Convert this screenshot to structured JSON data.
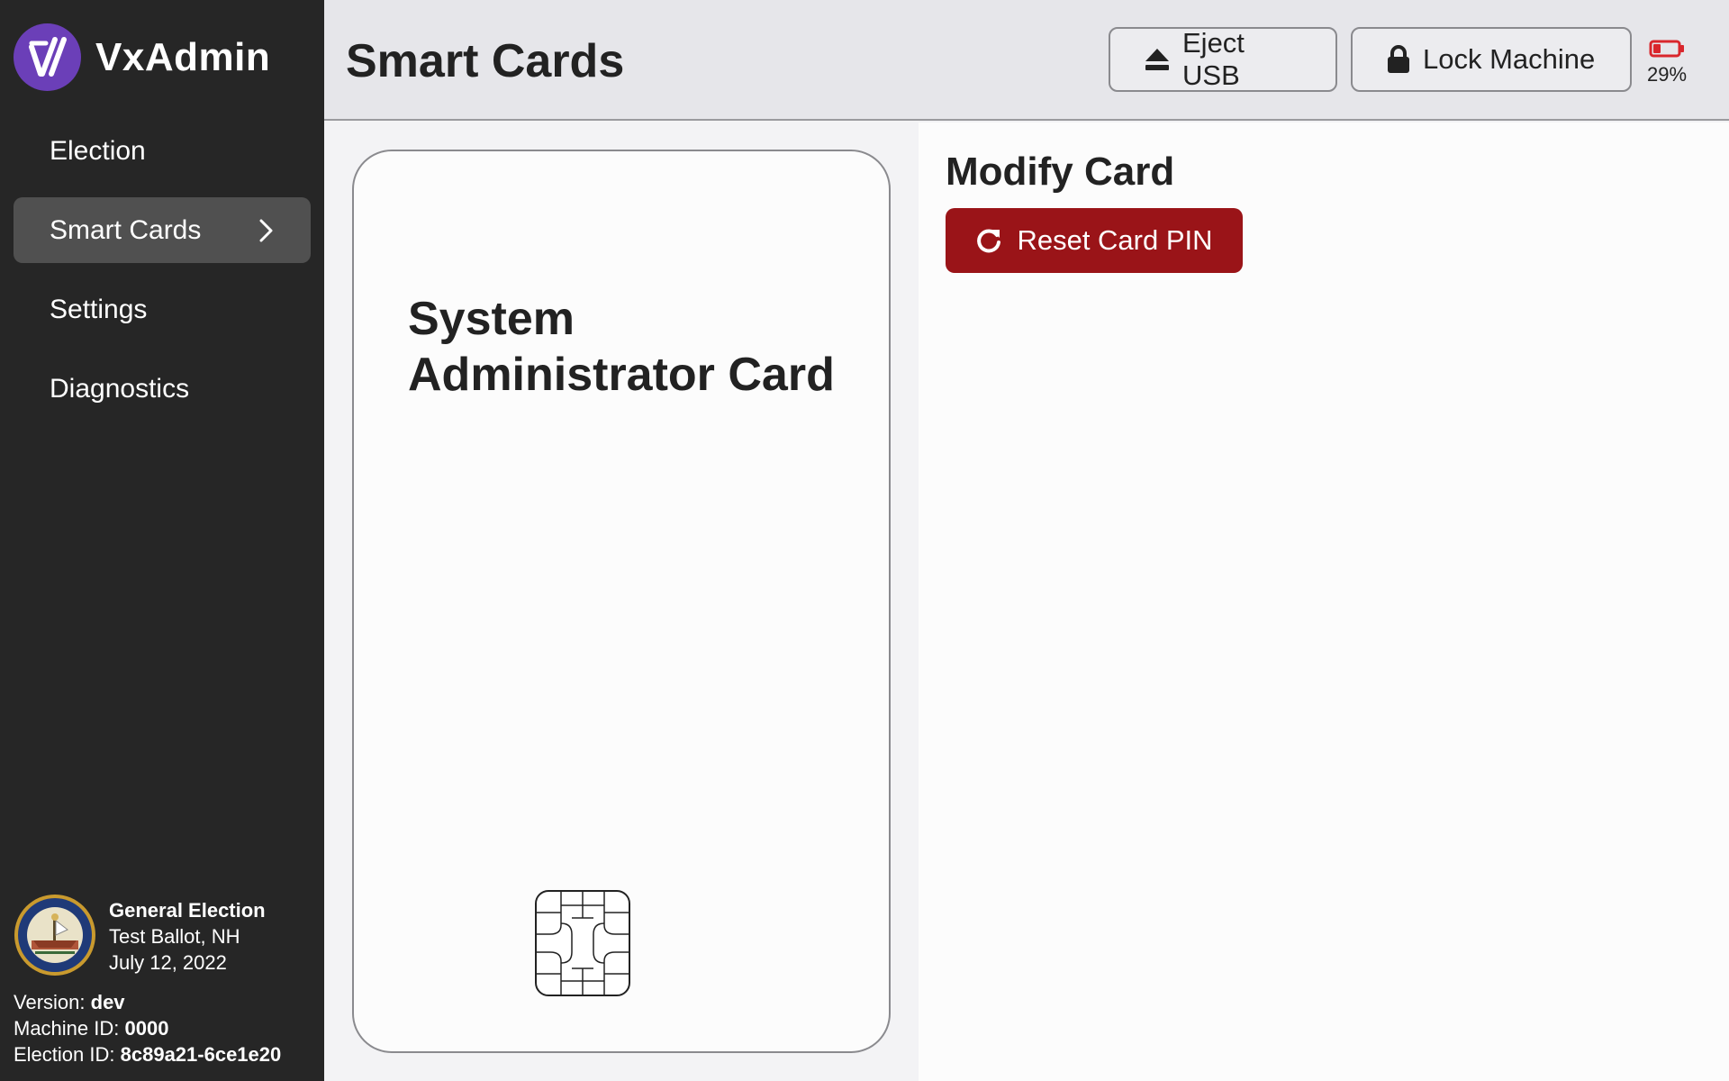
{
  "brand": {
    "name": "VxAdmin",
    "logo_icon": "vx-logo-icon",
    "logo_color": "#6b3fb8"
  },
  "nav": {
    "items": [
      {
        "label": "Election",
        "active": false
      },
      {
        "label": "Smart Cards",
        "active": true
      },
      {
        "label": "Settings",
        "active": false
      },
      {
        "label": "Diagnostics",
        "active": false
      }
    ]
  },
  "election": {
    "title": "General Election",
    "subtitle": "Test Ballot, NH",
    "date": "July 12, 2022"
  },
  "machine": {
    "version_label": "Version:",
    "version_value": "dev",
    "machine_id_label": "Machine ID:",
    "machine_id_value": "0000",
    "election_id_label": "Election ID:",
    "election_id_value": "8c89a21-6ce1e20"
  },
  "header": {
    "title": "Smart Cards",
    "eject_label": "Eject USB",
    "lock_label": "Lock Machine",
    "battery_text": "29%",
    "battery_level": 0.29,
    "battery_color": "#d9262c"
  },
  "card": {
    "title": "System Administrator Card"
  },
  "panel": {
    "title": "Modify Card",
    "reset_label": "Reset Card PIN",
    "reset_color": "#9a1418"
  }
}
